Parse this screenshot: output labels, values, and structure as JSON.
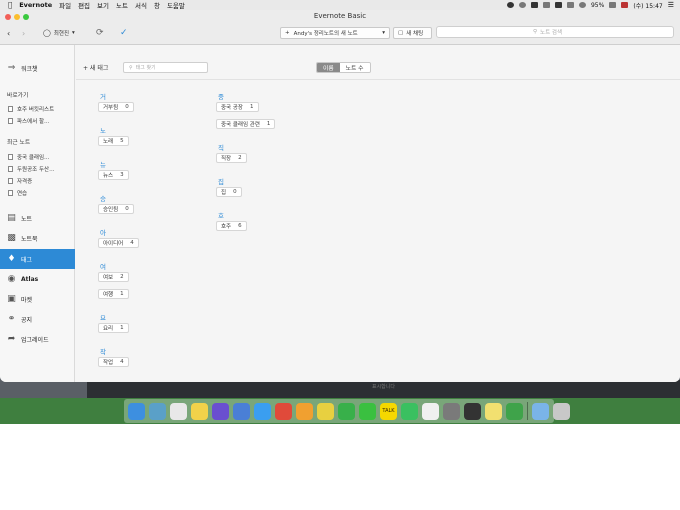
{
  "menubar": {
    "apple": "",
    "app_name": "Evernote",
    "items": [
      "파일",
      "편집",
      "보기",
      "노트",
      "서식",
      "창",
      "도움말"
    ],
    "battery": "95%",
    "clock": "(수) 15:47"
  },
  "window": {
    "title": "Evernote Basic",
    "user": "최현진",
    "notebook_selector": "Andy's 정리노트의 새 노트",
    "chat_button": "새 채팅",
    "search_placeholder": "노트 검색"
  },
  "sidebar": {
    "workchat": "워크챗",
    "shortcuts_title": "바로가기",
    "shortcuts": [
      "호주 버킷리스트",
      "파스에서 할…"
    ],
    "recent_title": "최근 노트",
    "recent": [
      "중국 클래임…",
      "두원공조 두산…",
      "자격증",
      "연습"
    ],
    "nav": [
      {
        "label": "노트",
        "icon": "notes-icon"
      },
      {
        "label": "노트북",
        "icon": "notebook-icon"
      },
      {
        "label": "태그",
        "icon": "tag-icon",
        "active": true
      },
      {
        "label": "Atlas",
        "icon": "globe-icon"
      },
      {
        "label": "마켓",
        "icon": "market-icon"
      },
      {
        "label": "공지",
        "icon": "announce-icon"
      },
      {
        "label": "업그레이드",
        "icon": "upgrade-icon"
      }
    ]
  },
  "tags_toolbar": {
    "new_tag": "+ 새 태그",
    "search_placeholder": "태그 찾기",
    "sort_name": "이름",
    "sort_count": "노트 수",
    "active_sort": "이름"
  },
  "tag_groups_col1": [
    {
      "letter": "거",
      "tags": [
        {
          "name": "거부됨",
          "count": "0"
        }
      ]
    },
    {
      "letter": "노",
      "tags": [
        {
          "name": "노래",
          "count": "5"
        }
      ]
    },
    {
      "letter": "뉴",
      "tags": [
        {
          "name": "뉴스",
          "count": "3"
        }
      ]
    },
    {
      "letter": "승",
      "tags": [
        {
          "name": "승인됨",
          "count": "0"
        }
      ]
    },
    {
      "letter": "아",
      "tags": [
        {
          "name": "아이디어",
          "count": "4"
        }
      ]
    },
    {
      "letter": "여",
      "tags": [
        {
          "name": "여보",
          "count": "2"
        },
        {
          "name": "여행",
          "count": "1"
        }
      ]
    },
    {
      "letter": "요",
      "tags": [
        {
          "name": "요리",
          "count": "1"
        }
      ]
    },
    {
      "letter": "작",
      "tags": [
        {
          "name": "작업",
          "count": "4"
        }
      ]
    }
  ],
  "tag_groups_col2": [
    {
      "letter": "중",
      "tags": [
        {
          "name": "중국 공장",
          "count": "1"
        },
        {
          "name": "중국 클래임 관련",
          "count": "1"
        }
      ]
    },
    {
      "letter": "직",
      "tags": [
        {
          "name": "직장",
          "count": "2"
        }
      ]
    },
    {
      "letter": "집",
      "tags": [
        {
          "name": "집",
          "count": "0"
        }
      ]
    },
    {
      "letter": "호",
      "tags": [
        {
          "name": "호주",
          "count": "6"
        }
      ]
    }
  ],
  "behind_window_text": "표시합니다",
  "dock": {
    "talk_label": "TALK",
    "apps": [
      "finder-icon",
      "photos-icon",
      "calendar-icon",
      "notes-app-icon",
      "imovie-icon",
      "keynote-icon",
      "safari-icon",
      "chrome-icon",
      "pages-icon",
      "photos2-icon",
      "numbers-icon",
      "wechat-icon",
      "kakaotalk-icon",
      "line-icon",
      "textedit-icon",
      "system-prefs-icon",
      "terminal-icon",
      "stickies-icon",
      "evernote-icon",
      "folder-icon",
      "trash-icon"
    ]
  },
  "colors": {
    "accent": "#2d8ad6",
    "sidebar_active": "#2d8ad6",
    "dock_bg": "#3f7f3f"
  }
}
